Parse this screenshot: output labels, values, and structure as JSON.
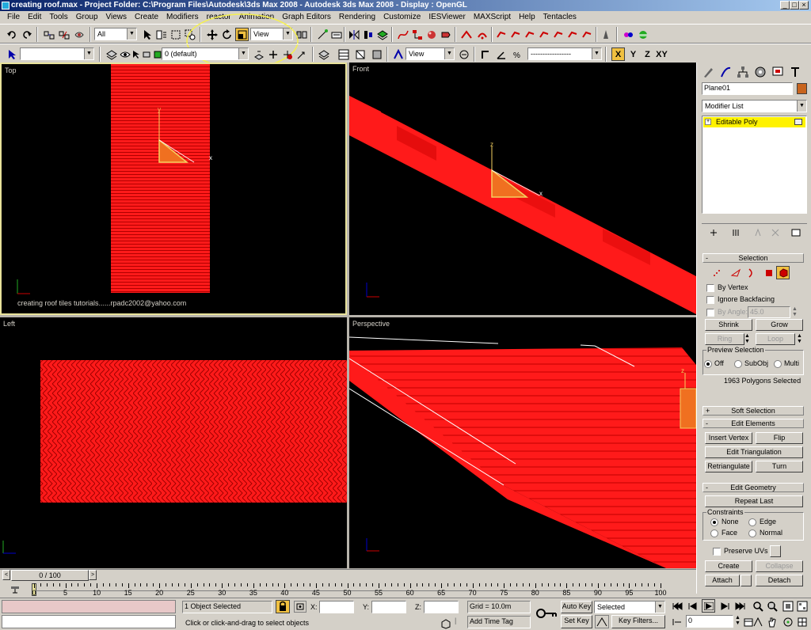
{
  "title": "creating roof.max  - Project Folder: C:\\Program Files\\Autodesk\\3ds Max 2008    - Autodesk 3ds Max 2008     - Display : OpenGL",
  "menu": [
    "File",
    "Edit",
    "Tools",
    "Group",
    "Views",
    "Create",
    "Modifiers",
    "reactor",
    "Animation",
    "Graph Editors",
    "Rendering",
    "Customize",
    "IESViewer",
    "MAXScript",
    "Help",
    "Tentacles"
  ],
  "toolbar": {
    "filter": "All",
    "refcoord": "View",
    "layer": "0 (default)",
    "view2": "View",
    "axis": [
      "X",
      "Y",
      "Z",
      "XY"
    ]
  },
  "viewports": {
    "top": "Top",
    "front": "Front",
    "left": "Left",
    "perspective": "Perspective",
    "caption": "creating roof tiles tutorials......rpadc2002@yahoo.com",
    "axis_labels": {
      "x": "x",
      "y": "y",
      "z": "z"
    }
  },
  "cmd": {
    "object_name": "Plane01",
    "object_color": "#c8641e",
    "modifier_list": "Modifier List",
    "stack_item": "Editable Poly",
    "selection": {
      "title": "Selection",
      "by_vertex": "By Vertex",
      "ignore_backfacing": "Ignore Backfacing",
      "by_angle": "By Angle:",
      "angle_value": "45.0",
      "shrink": "Shrink",
      "grow": "Grow",
      "ring": "Ring",
      "loop": "Loop",
      "preview_title": "Preview Selection",
      "preview_options": [
        "Off",
        "SubObj",
        "Multi"
      ],
      "status": "1963 Polygons Selected"
    },
    "soft_selection": "Soft Selection",
    "edit_elements": {
      "title": "Edit Elements",
      "insert_vertex": "Insert Vertex",
      "flip": "Flip",
      "edit_triangulation": "Edit Triangulation",
      "retriangulate": "Retriangulate",
      "turn": "Turn"
    },
    "edit_geometry": {
      "title": "Edit Geometry",
      "repeat_last": "Repeat Last",
      "constraints_title": "Constraints",
      "constraints": [
        "None",
        "Edge",
        "Face",
        "Normal"
      ],
      "preserve_uvs": "Preserve UVs",
      "create": "Create",
      "collapse": "Collapse",
      "attach": "Attach",
      "detach": "Detach"
    }
  },
  "timeline": {
    "frame": "0 / 100",
    "ticks": [
      "0",
      "5",
      "10",
      "15",
      "20",
      "25",
      "30",
      "35",
      "40",
      "45",
      "50",
      "55",
      "60",
      "65",
      "70",
      "75",
      "80",
      "85",
      "90",
      "95",
      "100"
    ]
  },
  "status": {
    "selected": "1 Object Selected",
    "prompt": "Click or click-and-drag to select objects",
    "x_label": "X:",
    "y_label": "Y:",
    "z_label": "Z:",
    "grid": "Grid = 10.0m",
    "add_time_tag": "Add Time Tag",
    "auto_key": "Auto Key",
    "set_key": "Set Key",
    "key_mode": "Selected",
    "key_filters": "Key Filters...",
    "frame_value": "0"
  },
  "colors": {
    "accent": "#ff0000",
    "viewport_active": "#e8e29a",
    "stack_highlight": "#fff200"
  }
}
